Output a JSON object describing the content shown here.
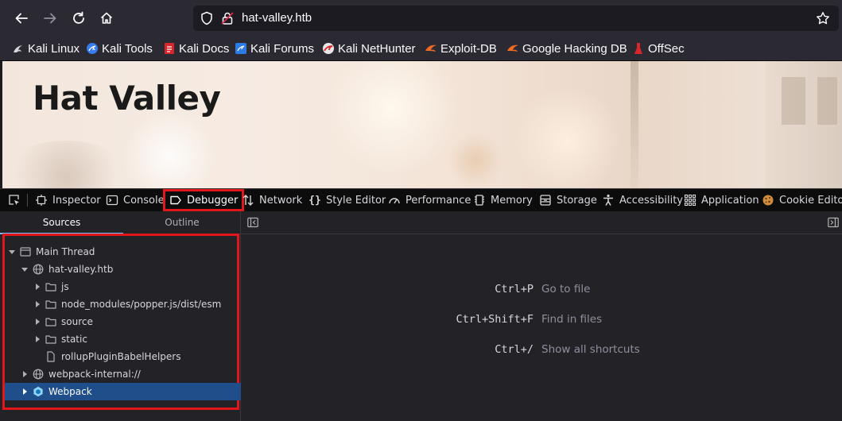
{
  "browser": {
    "url": "hat-valley.htb",
    "icons": [
      "back-icon",
      "forward-icon",
      "reload-icon",
      "home-icon",
      "shield-icon",
      "lock-icon",
      "star-icon"
    ]
  },
  "bookmarks": [
    {
      "label": "Kali Linux",
      "icon": "kali-dragon-icon"
    },
    {
      "label": "Kali Tools",
      "icon": "kali-tools-icon"
    },
    {
      "label": "Kali Docs",
      "icon": "kali-docs-icon"
    },
    {
      "label": "Kali Forums",
      "icon": "kali-forums-icon"
    },
    {
      "label": "Kali NetHunter",
      "icon": "nethunter-icon"
    },
    {
      "label": "Exploit-DB",
      "icon": "exploit-db-icon"
    },
    {
      "label": "Google Hacking DB",
      "icon": "ghdb-icon"
    },
    {
      "label": "OffSec",
      "icon": "offsec-icon"
    }
  ],
  "page": {
    "title": "Hat Valley"
  },
  "devtools": {
    "tabs": [
      {
        "label": "Inspector",
        "icon": "inspector-icon"
      },
      {
        "label": "Console",
        "icon": "console-icon"
      },
      {
        "label": "Debugger",
        "icon": "debugger-icon",
        "selected": true
      },
      {
        "label": "Network",
        "icon": "network-icon"
      },
      {
        "label": "Style Editor",
        "icon": "style-editor-icon"
      },
      {
        "label": "Performance",
        "icon": "performance-icon"
      },
      {
        "label": "Memory",
        "icon": "memory-icon"
      },
      {
        "label": "Storage",
        "icon": "storage-icon"
      },
      {
        "label": "Accessibility",
        "icon": "accessibility-icon"
      },
      {
        "label": "Application",
        "icon": "application-icon"
      },
      {
        "label": "Cookie Editor",
        "icon": "cookie-icon"
      }
    ],
    "left_tabs": {
      "sources": "Sources",
      "outline": "Outline"
    },
    "tree": [
      {
        "label": "Main Thread",
        "level": 0,
        "expanded": true,
        "icon": "window-icon"
      },
      {
        "label": "hat-valley.htb",
        "level": 1,
        "expanded": true,
        "icon": "globe-icon"
      },
      {
        "label": "js",
        "level": 2,
        "expanded": false,
        "icon": "folder-icon"
      },
      {
        "label": "node_modules/popper.js/dist/esm",
        "level": 2,
        "expanded": false,
        "icon": "folder-icon"
      },
      {
        "label": "source",
        "level": 2,
        "expanded": false,
        "icon": "folder-icon"
      },
      {
        "label": "static",
        "level": 2,
        "expanded": false,
        "icon": "folder-icon"
      },
      {
        "label": "rollupPluginBabelHelpers",
        "level": 2,
        "expanded": null,
        "icon": "file-icon"
      },
      {
        "label": "webpack-internal://",
        "level": 1,
        "expanded": false,
        "icon": "globe-icon"
      },
      {
        "label": "Webpack",
        "level": 1,
        "expanded": false,
        "icon": "webpack-icon",
        "selected": true
      }
    ],
    "shortcuts": [
      {
        "key": "Ctrl+P",
        "label": "Go to file"
      },
      {
        "key": "Ctrl+Shift+F",
        "label": "Find in files"
      },
      {
        "key": "Ctrl+/",
        "label": "Show all shortcuts"
      }
    ],
    "accent": "#75bfff",
    "selection_color": "#204e8a",
    "highlight_color": "#e3161c"
  }
}
